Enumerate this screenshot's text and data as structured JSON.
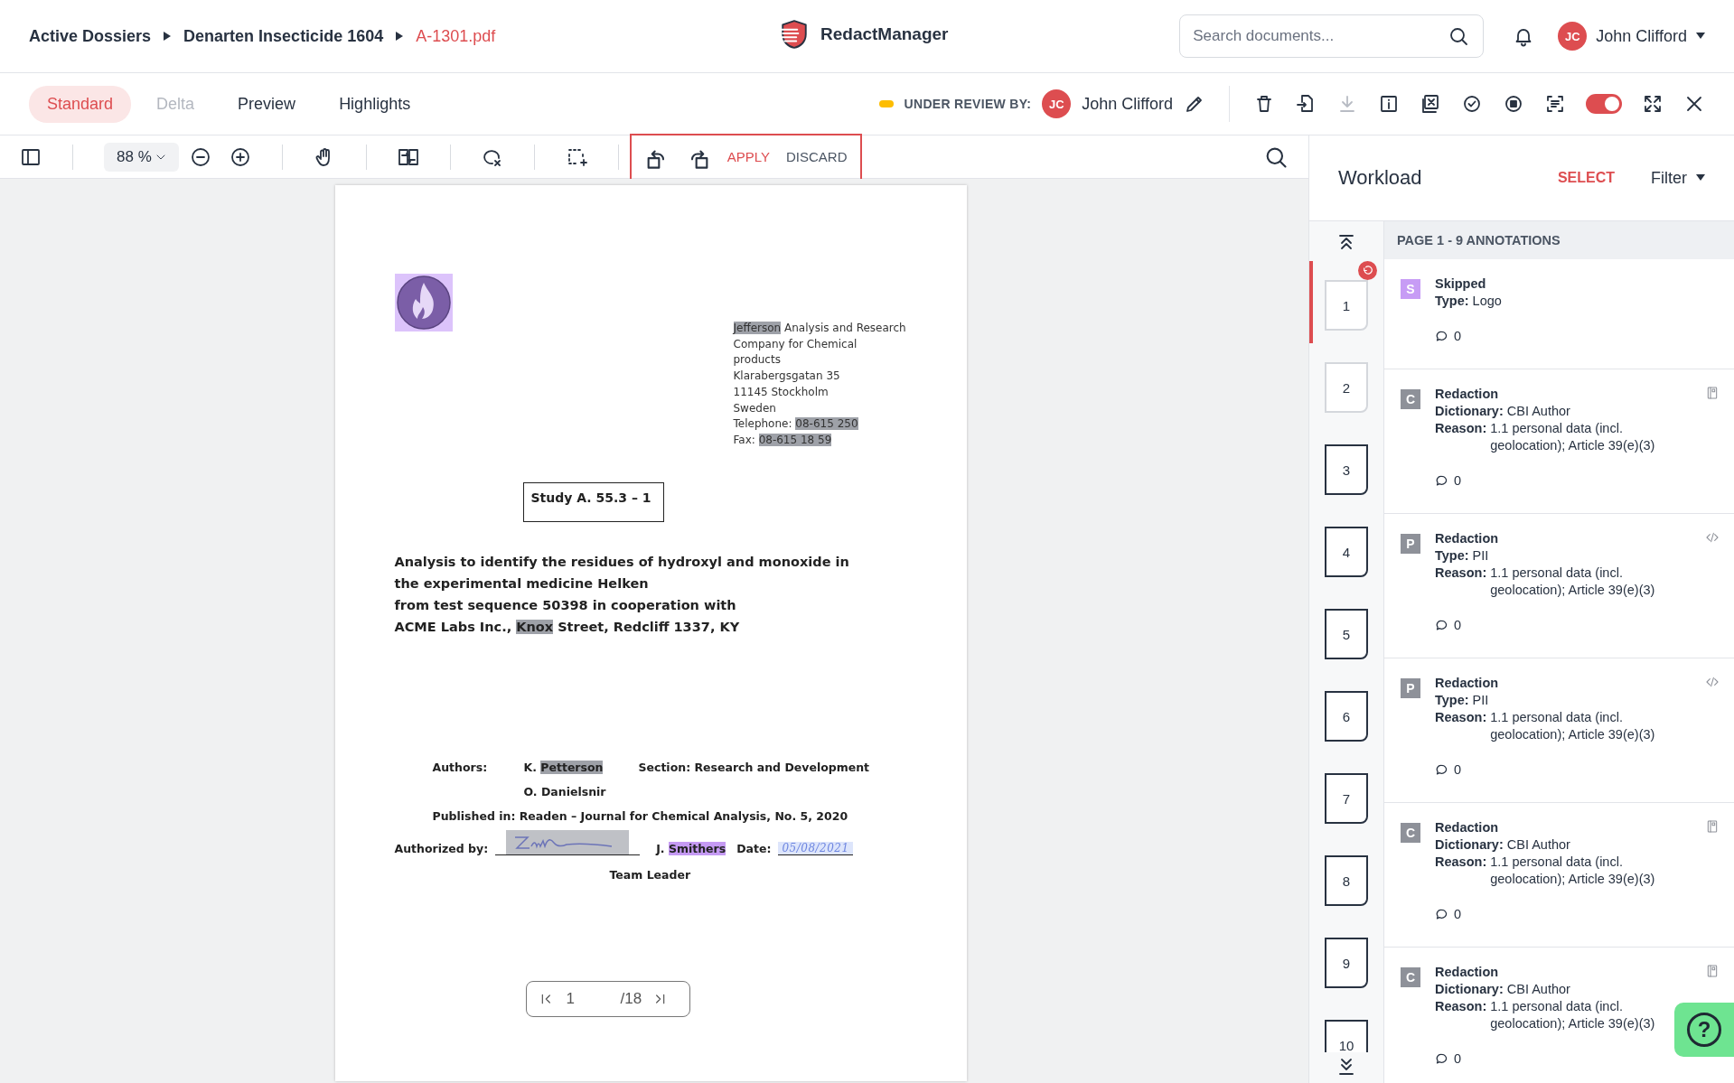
{
  "breadcrumbs": [
    {
      "label": "Active Dossiers",
      "current": false
    },
    {
      "label": "Denarten Insecticide 1604",
      "current": false
    },
    {
      "label": "A-1301.pdf",
      "current": true
    }
  ],
  "app_name": "RedactManager",
  "search": {
    "placeholder": "Search documents..."
  },
  "user": {
    "initials": "JC",
    "name": "John Clifford"
  },
  "view_tabs": [
    {
      "label": "Standard",
      "selected": true,
      "disabled": false
    },
    {
      "label": "Delta",
      "selected": false,
      "disabled": true
    },
    {
      "label": "Preview",
      "selected": false,
      "disabled": false
    },
    {
      "label": "Highlights",
      "selected": false,
      "disabled": false
    }
  ],
  "review": {
    "status": "UNDER REVIEW BY:",
    "color": "#fdbd00",
    "initials": "JC",
    "name": "John Clifford"
  },
  "document_actions": {
    "download_disabled": true,
    "toggle_on": true
  },
  "toolbar": {
    "zoom": "88 %",
    "apply": "APPLY",
    "discard": "DISCARD"
  },
  "document": {
    "address": [
      [
        {
          "text": "Jefferson",
          "redacted": true,
          "skipped": false
        },
        {
          "text": " Analysis and Research",
          "redacted": false,
          "skipped": false
        }
      ],
      [
        {
          "text": "Company for Chemical",
          "redacted": false,
          "skipped": false
        }
      ],
      [
        {
          "text": "products",
          "redacted": false,
          "skipped": false
        }
      ],
      [
        {
          "text": "Klarabergsgatan 35",
          "redacted": false,
          "skipped": false
        }
      ],
      [
        {
          "text": "11145 Stockholm",
          "redacted": false,
          "skipped": false
        }
      ],
      [
        {
          "text": "Sweden",
          "redacted": false,
          "skipped": false
        }
      ],
      [
        {
          "text": "Telephone: ",
          "redacted": false,
          "skipped": false
        },
        {
          "text": "08-615 250",
          "redacted": true,
          "skipped": false
        }
      ],
      [
        {
          "text": "Fax: ",
          "redacted": false,
          "skipped": false
        },
        {
          "text": "08-615 18 59",
          "redacted": true,
          "skipped": false
        }
      ]
    ],
    "study": "Study A. 55.3 – 1",
    "title": [
      [
        {
          "text": "Analysis to identify the residues of hydroxyl and monoxide in",
          "redacted": false,
          "skipped": false
        }
      ],
      [
        {
          "text": "the experimental medicine Helken",
          "redacted": false,
          "skipped": false
        }
      ],
      [
        {
          "text": "from test sequence 50398 in cooperation with",
          "redacted": false,
          "skipped": false
        }
      ],
      [
        {
          "text": "ACME Labs Inc., ",
          "redacted": false,
          "skipped": false
        },
        {
          "text": "Knox",
          "redacted": true,
          "skipped": false
        },
        {
          "text": " Street, Redcliff 1337, KY",
          "redacted": false,
          "skipped": false
        }
      ]
    ],
    "authors_label": "Authors:",
    "authors": [
      [
        {
          "text": "K. ",
          "redacted": false,
          "skipped": false
        },
        {
          "text": "Petterson",
          "redacted": true,
          "skipped": false
        }
      ],
      [
        {
          "text": "O. Danielsnir",
          "redacted": false,
          "skipped": false
        }
      ]
    ],
    "section": "Section: Research and Development",
    "published": "Published in: Readen – Journal for Chemical Analysis, No. 5, 2020",
    "authorized_label": "Authorized by:",
    "signer": [
      {
        "text": "J. ",
        "redacted": false,
        "skipped": false
      },
      {
        "text": "Smithers",
        "redacted": false,
        "skipped": true
      }
    ],
    "date_label": "Date:",
    "date": "05/08/2021",
    "role": "Team Leader"
  },
  "pager": {
    "page": "1",
    "total": "/18"
  },
  "workload": {
    "title": "Workload",
    "select": "SELECT",
    "filter": "Filter"
  },
  "pages": [
    {
      "number": "1",
      "selected": true,
      "viewed": true,
      "rotation_pending": true
    },
    {
      "number": "2",
      "selected": false,
      "viewed": true,
      "rotation_pending": false
    },
    {
      "number": "3",
      "selected": false,
      "viewed": false,
      "rotation_pending": false
    },
    {
      "number": "4",
      "selected": false,
      "viewed": false,
      "rotation_pending": false
    },
    {
      "number": "5",
      "selected": false,
      "viewed": false,
      "rotation_pending": false
    },
    {
      "number": "6",
      "selected": false,
      "viewed": false,
      "rotation_pending": false
    },
    {
      "number": "7",
      "selected": false,
      "viewed": false,
      "rotation_pending": false
    },
    {
      "number": "8",
      "selected": false,
      "viewed": false,
      "rotation_pending": false
    },
    {
      "number": "9",
      "selected": false,
      "viewed": false,
      "rotation_pending": false
    },
    {
      "number": "10",
      "selected": false,
      "viewed": false,
      "rotation_pending": false
    }
  ],
  "annotations_header": "PAGE 1 - 9 ANNOTATIONS",
  "annotations": [
    {
      "badge": "S",
      "color": "#c79cf5",
      "kind": "plain",
      "title": "Skipped",
      "fields": [
        {
          "label": "Type:",
          "value": "Logo"
        }
      ],
      "comments": "0"
    },
    {
      "badge": "C",
      "color": "#8e9199",
      "kind": "dictionary",
      "title": "Redaction",
      "fields": [
        {
          "label": "Dictionary:",
          "value": "CBI Author"
        },
        {
          "label": "Reason:",
          "value": "1.1 personal data (incl. geolocation); Article 39(e)(3)"
        }
      ],
      "comments": "0"
    },
    {
      "badge": "P",
      "color": "#8e9199",
      "kind": "rule",
      "title": "Redaction",
      "fields": [
        {
          "label": "Type:",
          "value": "PII"
        },
        {
          "label": "Reason:",
          "value": "1.1 personal data (incl. geolocation); Article 39(e)(3)"
        }
      ],
      "comments": "0"
    },
    {
      "badge": "P",
      "color": "#8e9199",
      "kind": "rule",
      "title": "Redaction",
      "fields": [
        {
          "label": "Type:",
          "value": "PII"
        },
        {
          "label": "Reason:",
          "value": "1.1 personal data (incl. geolocation); Article 39(e)(3)"
        }
      ],
      "comments": "0"
    },
    {
      "badge": "C",
      "color": "#8e9199",
      "kind": "dictionary",
      "title": "Redaction",
      "fields": [
        {
          "label": "Dictionary:",
          "value": "CBI Author"
        },
        {
          "label": "Reason:",
          "value": "1.1 personal data (incl. geolocation); Article 39(e)(3)"
        }
      ],
      "comments": "0"
    },
    {
      "badge": "C",
      "color": "#8e9199",
      "kind": "dictionary",
      "title": "Redaction",
      "fields": [
        {
          "label": "Dictionary:",
          "value": "CBI Author"
        },
        {
          "label": "Reason:",
          "value": "1.1 personal data (incl. geolocation); Article 39(e)(3)"
        }
      ],
      "comments": "0"
    }
  ],
  "help_button": {
    "label": "?"
  }
}
